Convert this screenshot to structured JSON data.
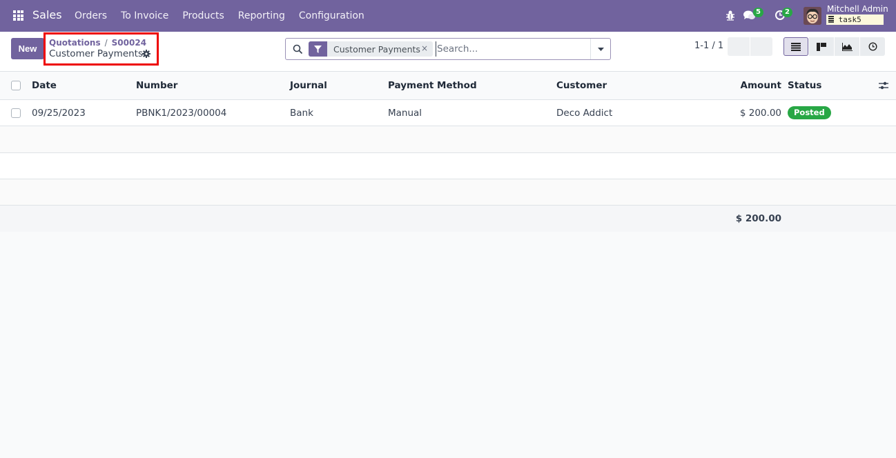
{
  "navbar": {
    "app_name": "Sales",
    "menu": [
      {
        "label": "Orders"
      },
      {
        "label": "To Invoice"
      },
      {
        "label": "Products"
      },
      {
        "label": "Reporting"
      },
      {
        "label": "Configuration"
      }
    ],
    "messages_count": "5",
    "activities_count": "2",
    "user_name": "Mitchell Admin",
    "database": "task5",
    "icons": {
      "apps": "apps-grid-icon",
      "debug": "bug-icon",
      "messages": "chat-icon",
      "activities": "clock-icon"
    }
  },
  "control_panel": {
    "new_label": "New",
    "breadcrumb": [
      {
        "label": "Quotations"
      },
      {
        "label": "S00024"
      }
    ],
    "breadcrumb_separator": "/",
    "current_title": "Customer Payments",
    "search": {
      "facet_label": "Customer Payments",
      "facet_remove": "×",
      "placeholder": "Search...",
      "value": ""
    },
    "pager": "1-1 / 1",
    "views": [
      "list",
      "kanban",
      "graph",
      "activity"
    ],
    "active_view": "list"
  },
  "table": {
    "columns": [
      {
        "label": "Date"
      },
      {
        "label": "Number"
      },
      {
        "label": "Journal"
      },
      {
        "label": "Payment Method"
      },
      {
        "label": "Customer"
      },
      {
        "label": "Amount"
      },
      {
        "label": "Status"
      }
    ],
    "rows": [
      {
        "date": "09/25/2023",
        "number": "PBNK1/2023/00004",
        "journal": "Bank",
        "payment_method": "Manual",
        "customer": "Deco Addict",
        "amount": "$ 200.00",
        "status": "Posted"
      }
    ],
    "total_amount": "$ 200.00"
  },
  "colors": {
    "brand": "#71639e",
    "status_posted": "#28a745",
    "highlight_border": "#e00000"
  }
}
